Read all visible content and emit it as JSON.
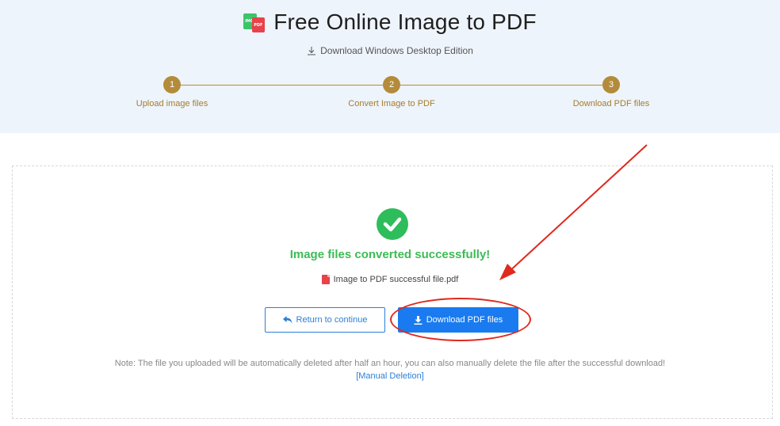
{
  "header": {
    "title": "Free Online Image to PDF",
    "logo_img_text": "IMG",
    "logo_pdf_text": "PDF",
    "desktop_link": "Download Windows Desktop Edition"
  },
  "steps": [
    {
      "number": "1",
      "label": "Upload image files"
    },
    {
      "number": "2",
      "label": "Convert Image to PDF"
    },
    {
      "number": "3",
      "label": "Download PDF files"
    }
  ],
  "result": {
    "success_message": "Image files converted successfully!",
    "file_name": "Image to PDF successful file.pdf",
    "return_label": "Return to continue",
    "download_label": "Download PDF files",
    "note": "Note: The file you uploaded will be automatically deleted after half an hour, you can also manually delete the file after the successful download!",
    "manual_deletion": "[Manual Deletion]"
  },
  "colors": {
    "step_gold": "#b38b3a",
    "success_green": "#3cbc55",
    "primary_blue": "#1a7bf0",
    "annotation_red": "#e0291f"
  }
}
